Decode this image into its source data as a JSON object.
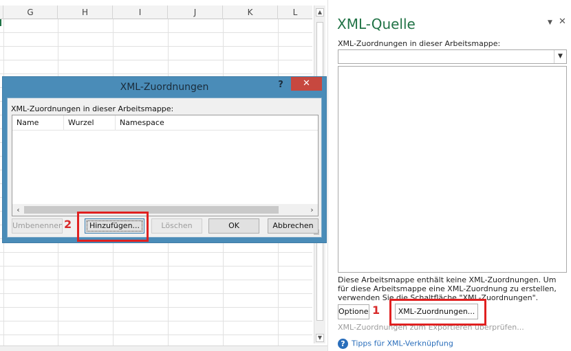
{
  "sheet": {
    "columns": [
      "G",
      "H",
      "I",
      "J",
      "K",
      "L"
    ]
  },
  "dialog": {
    "title": "XML-Zuordnungen",
    "help": "?",
    "close": "✕",
    "list_label": "XML-Zuordnungen in dieser Arbeitsmappe:",
    "list_headers": [
      "Name",
      "Wurzel",
      "Namespace"
    ],
    "buttons": {
      "rename": "Umbenennen",
      "add": "Hinzufügen...",
      "delete": "Löschen",
      "ok": "OK",
      "cancel": "Abbrechen"
    }
  },
  "callouts": {
    "one": "1",
    "two": "2"
  },
  "pane": {
    "title": "XML-Quelle",
    "menu_glyph": "▼",
    "close_glyph": "✕",
    "sublabel": "XML-Zuordnungen in dieser Arbeitsmappe:",
    "info": "Diese Arbeitsmappe enthält keine XML-Zuordnungen. Um für diese Arbeitsmappe eine XML-Zuordnung zu erstellen, verwenden Sie die Schaltfläche \"XML-Zuordnungen\".",
    "options_button": "Optionen",
    "maps_button": "XML-Zuordnungen...",
    "verify_link": "XML-Zuordnungen zum Exportieren überprüfen...",
    "help_link": "Tipps für XML-Verknüpfung"
  },
  "colors": {
    "accent_green": "#217346",
    "dialog_frame": "#4a8cb8",
    "close_red": "#c7483f",
    "highlight_red": "#e02020",
    "link_blue": "#2a6ebb"
  }
}
